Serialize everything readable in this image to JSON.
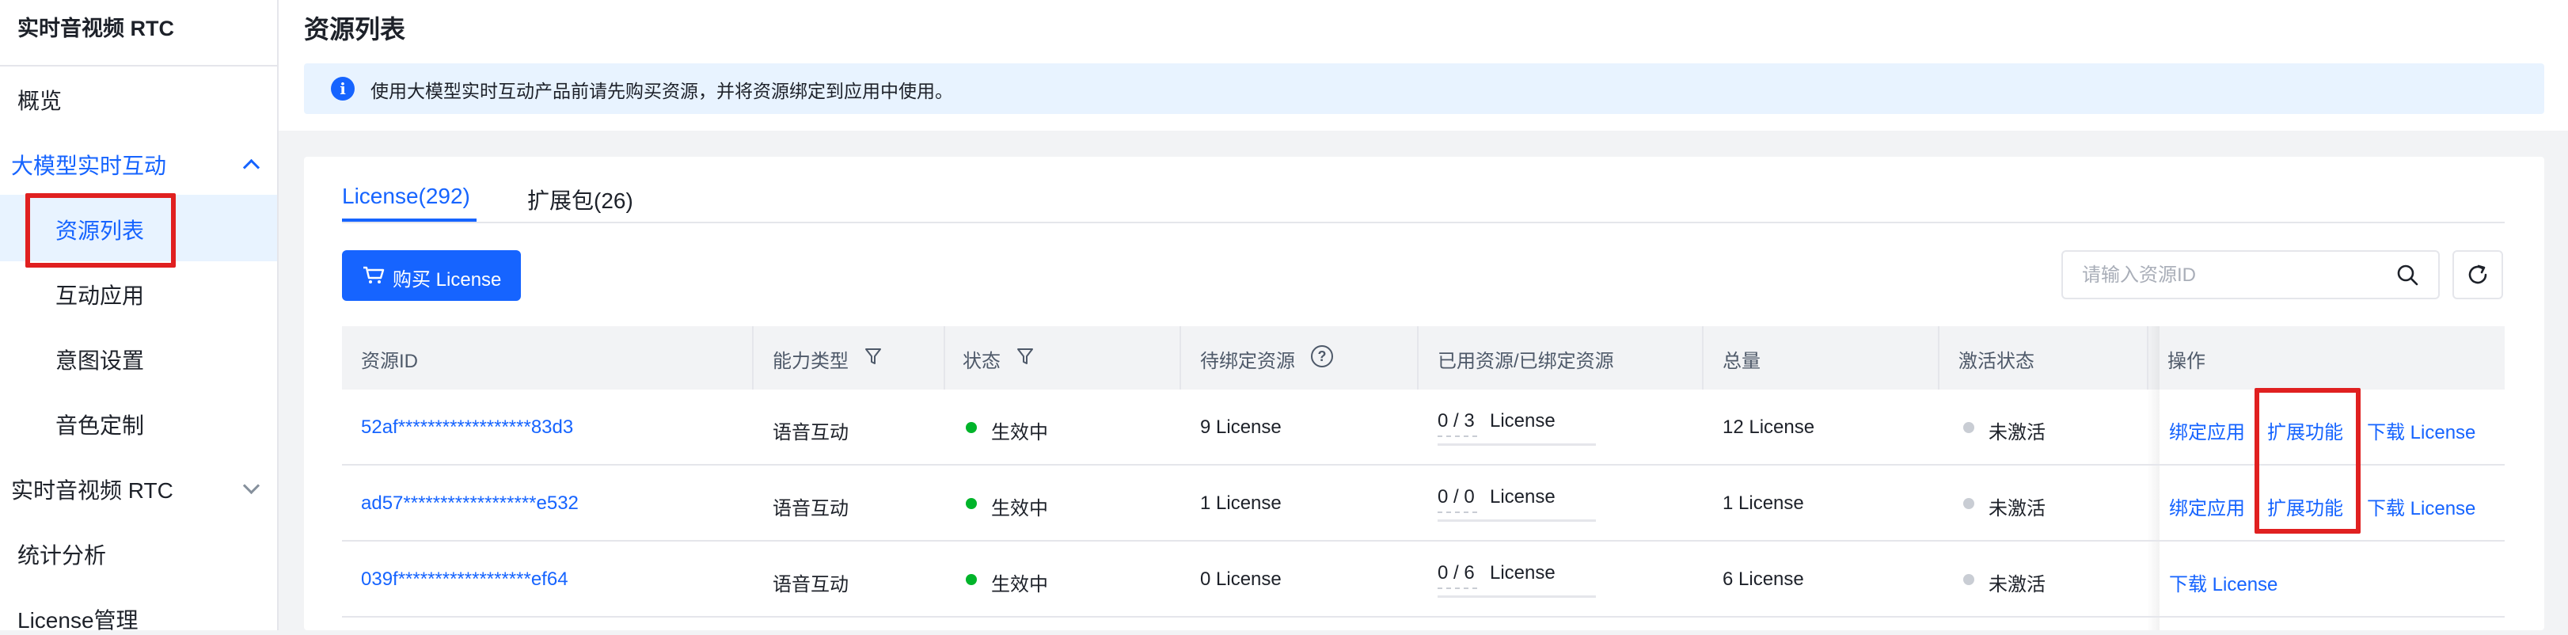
{
  "sidebar": {
    "title": "实时音视频 RTC",
    "items": [
      {
        "label": "概览"
      },
      {
        "label": "大模型实时互动"
      },
      {
        "label": "资源列表"
      },
      {
        "label": "互动应用"
      },
      {
        "label": "意图设置"
      },
      {
        "label": "音色定制"
      },
      {
        "label": "实时音视频 RTC"
      },
      {
        "label": "统计分析"
      },
      {
        "label": "License管理"
      }
    ]
  },
  "page": {
    "title": "资源列表",
    "alert": "使用大模型实时互动产品前请先购买资源，并将资源绑定到应用中使用。",
    "alert_icon": "info-icon"
  },
  "tabs": [
    {
      "label": "License(292)"
    },
    {
      "label": "扩展包(26)"
    }
  ],
  "toolbar": {
    "buy_label": "购买 License",
    "search_placeholder": "请输入资源ID"
  },
  "table": {
    "columns": [
      "资源ID",
      "能力类型",
      "状态",
      "待绑定资源",
      "已用资源/已绑定资源",
      "总量",
      "激活状态",
      "操作"
    ],
    "rows": [
      {
        "id": "52af******************83d3",
        "type": "语音互动",
        "status": "生效中",
        "pending": "9 License",
        "used": "0 / 3",
        "used_unit": "License",
        "total": "12 License",
        "activation": "未激活",
        "actions": [
          "绑定应用",
          "扩展功能",
          "下载 License"
        ]
      },
      {
        "id": "ad57******************e532",
        "type": "语音互动",
        "status": "生效中",
        "pending": "1 License",
        "used": "0 / 0",
        "used_unit": "License",
        "total": "1 License",
        "activation": "未激活",
        "actions": [
          "绑定应用",
          "扩展功能",
          "下载 License"
        ]
      },
      {
        "id": "039f******************ef64",
        "type": "语音互动",
        "status": "生效中",
        "pending": "0 License",
        "used": "0 / 6",
        "used_unit": "License",
        "total": "6 License",
        "activation": "未激活",
        "actions": [
          "下载 License"
        ]
      }
    ]
  },
  "colors": {
    "accent": "#1664ff",
    "active_status": "#00b42a",
    "inactive_status": "#c9cdd4",
    "highlight_box": "#e02020"
  }
}
